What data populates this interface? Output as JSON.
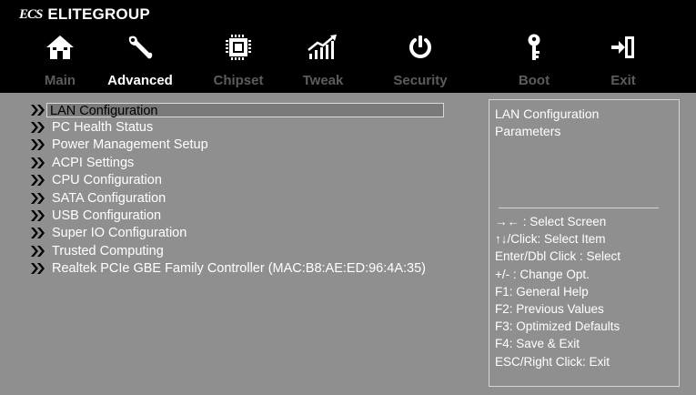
{
  "brand": {
    "logo": "ECS",
    "name": "ELITEGROUP"
  },
  "tabs": [
    {
      "label": "Main",
      "icon": "home-icon",
      "active": false
    },
    {
      "label": "Advanced",
      "icon": "wrench-icon",
      "active": true
    },
    {
      "label": "Chipset",
      "icon": "chip-icon",
      "active": false
    },
    {
      "label": "Tweak",
      "icon": "tweak-chart-icon",
      "active": false
    },
    {
      "label": "Security",
      "icon": "power-icon",
      "active": false
    },
    {
      "label": "Boot",
      "icon": "key-icon",
      "active": false
    },
    {
      "label": "Exit",
      "icon": "exit-icon",
      "active": false
    }
  ],
  "menu": {
    "items": [
      "LAN Configuration",
      "PC Health Status",
      "Power Management Setup",
      "ACPI Settings",
      "CPU Configuration",
      "SATA Configuration",
      "USB Configuration",
      "Super IO Configuration",
      "Trusted Computing",
      "Realtek PCIe GBE Family Controller (MAC:B8:AE:ED:96:4A:35)"
    ],
    "selected_index": 0
  },
  "help": {
    "title": "LAN Configuration Parameters",
    "keys": [
      "→← : Select Screen",
      "↑↓/Click: Select Item",
      "Enter/Dbl Click : Select",
      "+/- : Change Opt.",
      "F1: General Help",
      "F2: Previous Values",
      "F3: Optimized Defaults",
      "F4: Save & Exit",
      "ESC/Right Click: Exit"
    ]
  },
  "colors": {
    "top_bar": "#000000",
    "panel": "#8f8f8f",
    "tab_inactive": "#5c5c5c",
    "tab_active": "#ffffff",
    "text": "#ffffff",
    "border": "#d6d6d6"
  }
}
